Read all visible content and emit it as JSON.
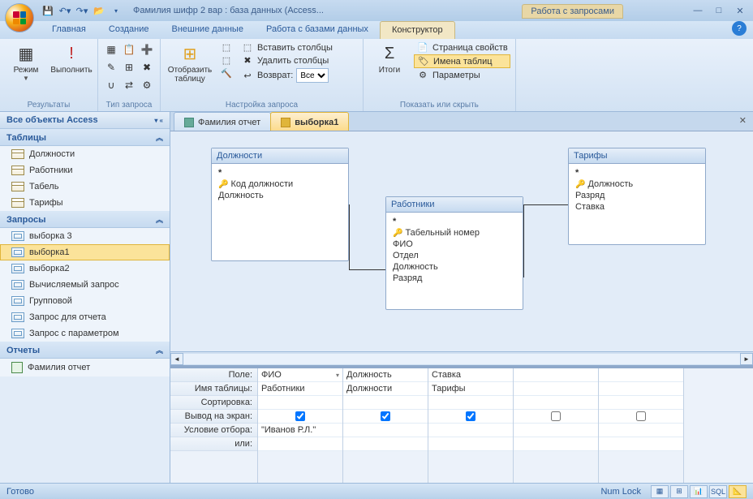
{
  "title": "Фамилия шифр 2 вар : база данных (Access...",
  "context_tab_group": "Работа с запросами",
  "menu": {
    "t1": "Главная",
    "t2": "Создание",
    "t3": "Внешние данные",
    "t4": "Работа с базами данных",
    "t5": "Конструктор"
  },
  "ribbon": {
    "g1": {
      "cap": "Результаты",
      "mode": "Режим",
      "run": "Выполнить"
    },
    "g2": {
      "cap": "Тип запроса"
    },
    "g3": {
      "cap": "Настройка запроса",
      "showtbl": "Отобразить таблицу",
      "inscol": "Вставить столбцы",
      "delcol": "Удалить столбцы",
      "ret": "Возврат:",
      "retval": "Все"
    },
    "g4": {
      "cap": "Показать или скрыть",
      "totals": "Итоги",
      "props": "Страница свойств",
      "names": "Имена таблиц",
      "params": "Параметры"
    }
  },
  "nav": {
    "header": "Все объекты Access",
    "cat_tables": "Таблицы",
    "tables": [
      "Должности",
      "Работники",
      "Табель",
      "Тарифы"
    ],
    "cat_queries": "Запросы",
    "queries": [
      "выборка 3",
      "выборка1",
      "выборка2",
      "Вычисляемый запрос",
      "Групповой",
      "Запрос для отчета",
      "Запрос с параметром"
    ],
    "cat_reports": "Отчеты",
    "reports": [
      "Фамилия отчет"
    ]
  },
  "docs": {
    "t1": "Фамилия отчет",
    "t2": "выборка1"
  },
  "diagram": {
    "box1": {
      "title": "Должности",
      "fields": {
        "f0": "*",
        "f1": "Код должности",
        "f2": "Должность"
      }
    },
    "box2": {
      "title": "Работники",
      "fields": {
        "f0": "*",
        "f1": "Табельный номер",
        "f2": "ФИО",
        "f3": "Отдел",
        "f4": "Должность",
        "f5": "Разряд"
      }
    },
    "box3": {
      "title": "Тарифы",
      "fields": {
        "f0": "*",
        "f1": "Должность",
        "f2": "Разряд",
        "f3": "Ставка"
      }
    }
  },
  "grid": {
    "labels": {
      "l1": "Поле:",
      "l2": "Имя таблицы:",
      "l3": "Сортировка:",
      "l4": "Вывод на экран:",
      "l5": "Условие отбора:",
      "l6": "или:"
    },
    "cols": [
      {
        "field": "ФИО",
        "table": "Работники",
        "show": true,
        "crit": "\"Иванов Р.Л.\""
      },
      {
        "field": "Должность",
        "table": "Должности",
        "show": true,
        "crit": ""
      },
      {
        "field": "Ставка",
        "table": "Тарифы",
        "show": true,
        "crit": ""
      },
      {
        "field": "",
        "table": "",
        "show": false,
        "crit": ""
      },
      {
        "field": "",
        "table": "",
        "show": false,
        "crit": ""
      }
    ]
  },
  "status": {
    "ready": "Готово",
    "numlock": "Num Lock",
    "sql": "SQL"
  }
}
